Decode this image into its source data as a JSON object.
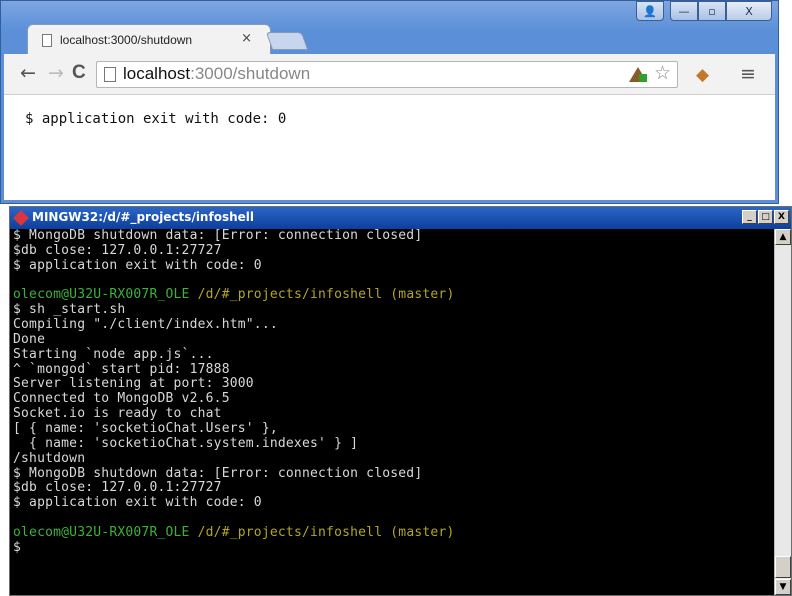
{
  "browser": {
    "tab": {
      "title": "localhost:3000/shutdown",
      "close": "×"
    },
    "window_controls": {
      "user": "👤",
      "minimize": "—",
      "maximize": "▫",
      "close": "X"
    },
    "nav": {
      "back": "←",
      "forward": "→",
      "reload": "C"
    },
    "omnibox": {
      "host": "localhost",
      "rest": ":3000/shutdown"
    },
    "menu": "≡",
    "star": "☆",
    "page_text": "$ application exit with code: 0"
  },
  "console": {
    "title": "MINGW32:/d/#_projects/infoshell",
    "buttons": {
      "minimize": "_",
      "maximize": "□",
      "close": "X"
    },
    "lines": [
      {
        "text": "$ MongoDB shutdown data: [Error: connection closed]"
      },
      {
        "text": "$db close: 127.0.0.1:27727"
      },
      {
        "text": "$ application exit with code: 0"
      },
      {
        "text": ""
      },
      {
        "user": "olecom@U32U-RX007R_OLE",
        "path": " /d/#_projects/infoshell (master)"
      },
      {
        "text": "$ sh _start.sh"
      },
      {
        "text": "Compiling \"./client/index.htm\"..."
      },
      {
        "text": "Done"
      },
      {
        "text": "Starting `node app.js`..."
      },
      {
        "text": "^ `mongod` start pid: 17888"
      },
      {
        "text": "Server listening at port: 3000"
      },
      {
        "text": "Connected to MongoDB v2.6.5"
      },
      {
        "text": "Socket.io is ready to chat"
      },
      {
        "text": "[ { name: 'socketioChat.Users' },"
      },
      {
        "text": "  { name: 'socketioChat.system.indexes' } ]"
      },
      {
        "text": "/shutdown"
      },
      {
        "text": "$ MongoDB shutdown data: [Error: connection closed]"
      },
      {
        "text": "$db close: 127.0.0.1:27727"
      },
      {
        "text": "$ application exit with code: 0"
      },
      {
        "text": ""
      },
      {
        "user": "olecom@U32U-RX007R_OLE",
        "path": " /d/#_projects/infoshell (master)"
      },
      {
        "text": "$"
      }
    ]
  }
}
